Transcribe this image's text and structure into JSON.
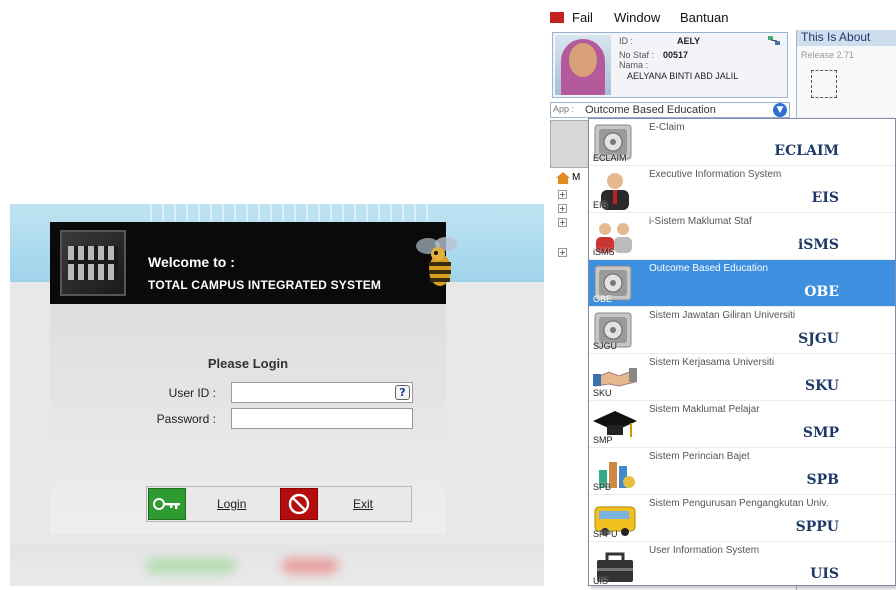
{
  "login": {
    "welcome": "Welcome to :",
    "system_name": "TOTAL CAMPUS INTEGRATED SYSTEM",
    "please_login": "Please Login",
    "user_id_label": "User ID :",
    "password_label": "Password :",
    "user_id_value": "",
    "password_value": "",
    "help_glyph": "?",
    "login_label": "Login",
    "exit_label": "Exit"
  },
  "menubar": {
    "items": [
      "Fail",
      "Window",
      "Bantuan"
    ]
  },
  "profile": {
    "id_label": "ID :",
    "id_value": "AELY",
    "staff_label": "No Staf :",
    "staff_value": "00517",
    "name_label": "Nama :",
    "name_value": "AELYANA BINTI ABD JALIL"
  },
  "about": {
    "title": "This Is About",
    "release": "Release 2.71"
  },
  "app_select": {
    "prefix": "App :",
    "value": "Outcome Based Education"
  },
  "tree": {
    "root_label": "M"
  },
  "apps": [
    {
      "code": "ECLAIM",
      "desc": "E-Claim",
      "small": "ECLAIM",
      "icon": "gear-box-icon",
      "selected": false
    },
    {
      "code": "EIS",
      "desc": "Executive Information System",
      "small": "EIS",
      "icon": "executive-icon",
      "selected": false
    },
    {
      "code": "iSMS",
      "desc": "i-Sistem Maklumat Staf",
      "small": "iSMS",
      "icon": "staff-group-icon",
      "selected": false
    },
    {
      "code": "OBE",
      "desc": "Outcome Based Education",
      "small": "OBE",
      "icon": "gear-box-icon",
      "selected": true
    },
    {
      "code": "SJGU",
      "desc": "Sistem Jawatan Giliran Universiti",
      "small": "SJGU",
      "icon": "gear-box-icon",
      "selected": false
    },
    {
      "code": "SKU",
      "desc": "Sistem Kerjasama Universiti",
      "small": "SKU",
      "icon": "handshake-icon",
      "selected": false
    },
    {
      "code": "SMP",
      "desc": "Sistem Maklumat Pelajar",
      "small": "SMP",
      "icon": "graduation-cap-icon",
      "selected": false
    },
    {
      "code": "SPB",
      "desc": "Sistem Perincian Bajet",
      "small": "SPB",
      "icon": "budget-chart-icon",
      "selected": false
    },
    {
      "code": "SPPU",
      "desc": "Sistem Pengurusan Pengangkutan Univ.",
      "small": "SPPU",
      "icon": "bus-icon",
      "selected": false
    },
    {
      "code": "UIS",
      "desc": "User Information System",
      "small": "UIS",
      "icon": "toolbox-icon",
      "selected": false
    }
  ]
}
